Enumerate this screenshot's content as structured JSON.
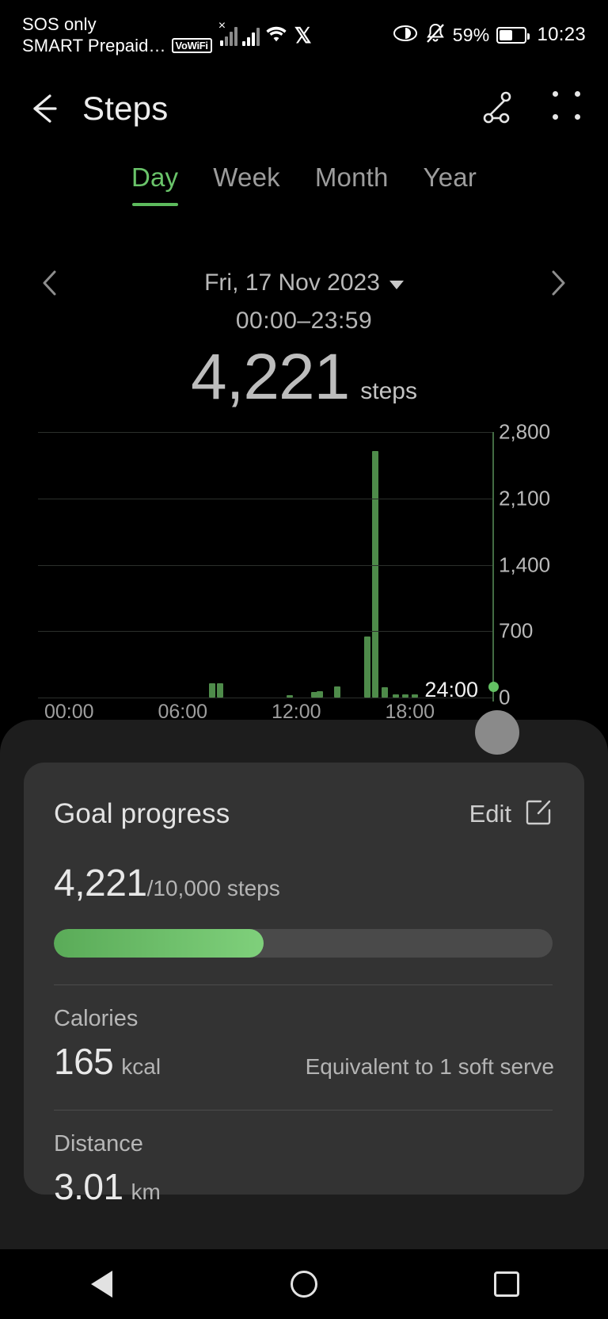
{
  "status_bar": {
    "carrier_line1": "SOS only",
    "carrier_line2": "SMART Prepaid…",
    "vowifi_badge": "VoWiFi",
    "twitter_glyph": "𝕏",
    "battery_percent": "59%",
    "clock": "10:23",
    "icons": [
      "signal-bars-icon",
      "signal-bars-icon",
      "wifi-icon",
      "x-app-icon",
      "eye-comfort-icon",
      "mute-bell-icon",
      "battery-icon"
    ]
  },
  "app_bar": {
    "back_icon": "back-arrow-icon",
    "title": "Steps",
    "share_icon": "share-icon",
    "menu_icon": "more-options-icon"
  },
  "tabs": [
    {
      "label": "Day",
      "active": true
    },
    {
      "label": "Week",
      "active": false
    },
    {
      "label": "Month",
      "active": false
    },
    {
      "label": "Year",
      "active": false
    }
  ],
  "date_nav": {
    "prev_icon": "chevron-left-icon",
    "next_icon": "chevron-right-icon",
    "date": "Fri, 17 Nov 2023",
    "dropdown_icon": "caret-down-icon"
  },
  "summary": {
    "time_range": "00:00–23:59",
    "steps_value": "4,221",
    "steps_unit": "steps"
  },
  "chart_data": {
    "type": "bar",
    "title": "Steps per time of day",
    "xlabel": "",
    "ylabel": "steps",
    "ylim": [
      0,
      2800
    ],
    "yticks": [
      0,
      700,
      1400,
      2100,
      2800
    ],
    "ytick_labels": [
      "0",
      "700",
      "1,400",
      "2,100",
      "2,800"
    ],
    "xticks": [
      "00:00",
      "06:00",
      "12:00",
      "18:00",
      "24:00"
    ],
    "xlim_hours": [
      0,
      24
    ],
    "grid": true,
    "legend": "none",
    "accent_color": "#4e8b4a",
    "cursor": {
      "label": "24:00",
      "hours": 24,
      "color": "#63c063"
    },
    "series": [
      {
        "name": "Steps",
        "points": [
          {
            "hour": 9.2,
            "value": 150
          },
          {
            "hour": 9.6,
            "value": 150
          },
          {
            "hour": 13.3,
            "value": 25
          },
          {
            "hour": 14.6,
            "value": 60
          },
          {
            "hour": 14.9,
            "value": 65
          },
          {
            "hour": 15.8,
            "value": 120
          },
          {
            "hour": 17.4,
            "value": 640
          },
          {
            "hour": 17.8,
            "value": 2600
          },
          {
            "hour": 18.3,
            "value": 110
          },
          {
            "hour": 18.9,
            "value": 35
          },
          {
            "hour": 19.4,
            "value": 35
          },
          {
            "hour": 19.9,
            "value": 30
          }
        ]
      }
    ]
  },
  "goal_card": {
    "title": "Goal progress",
    "edit_label": "Edit",
    "edit_icon": "edit-pencil-icon",
    "current": "4,221",
    "target_text": "/10,000 steps",
    "progress_percent": 42,
    "progress_fill_color": "#6cc468"
  },
  "stats": [
    {
      "label": "Calories",
      "value": "165",
      "unit": "kcal",
      "note": "Equivalent to 1 soft serve"
    },
    {
      "label": "Distance",
      "value": "3.01",
      "unit": "km",
      "note": ""
    }
  ],
  "nav_bar": {
    "back": "nav-back-triangle-icon",
    "home": "nav-home-circle-icon",
    "recents": "nav-recents-square-icon"
  }
}
